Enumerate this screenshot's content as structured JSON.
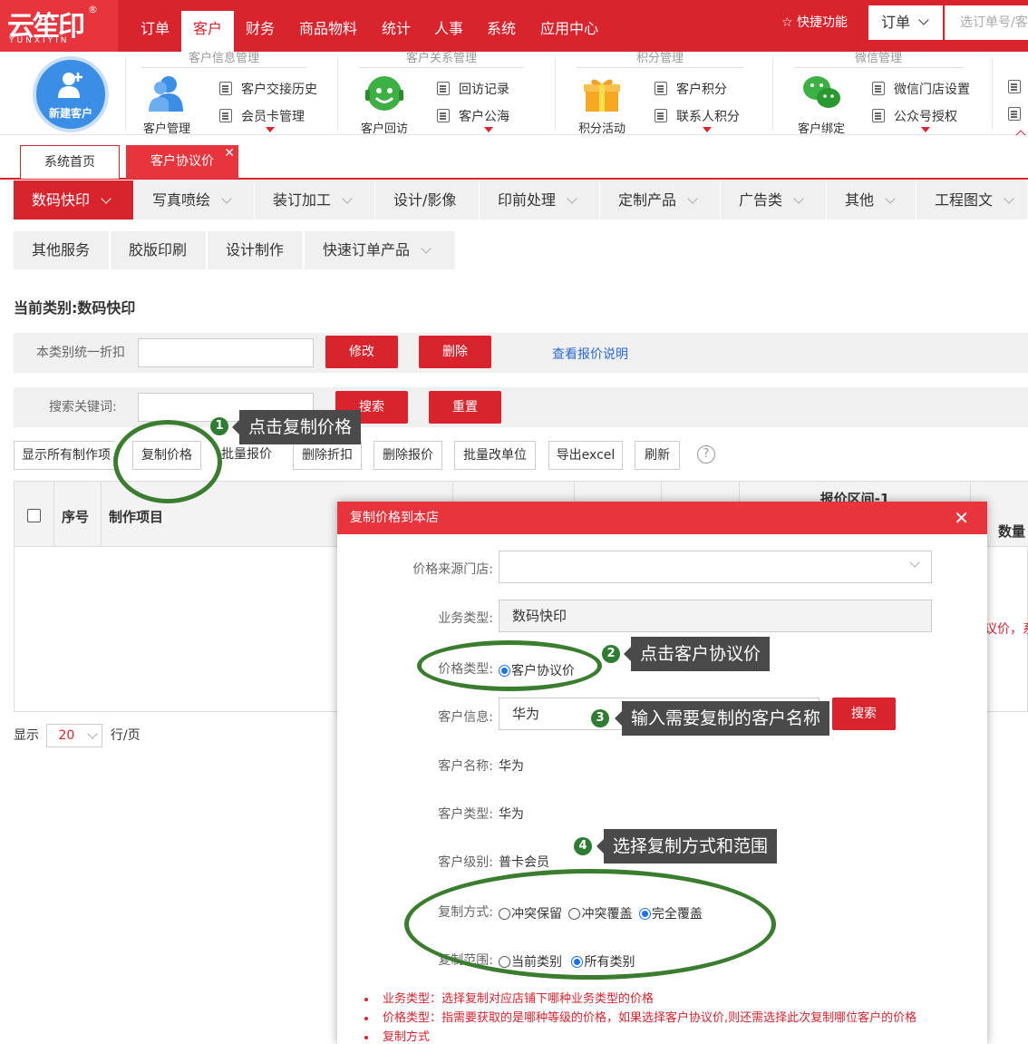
{
  "app": {
    "logo_text": "云笙印",
    "logo_sub": "YUNXIYIN",
    "nav": [
      "订单",
      "客户",
      "财务",
      "商品物料",
      "统计",
      "人事",
      "系统",
      "应用中心"
    ],
    "active_nav": "客户",
    "quick_func": "☆ 快捷功能",
    "order_select": "订单",
    "order_search_placeholder": "选订单号/客"
  },
  "ribbon": {
    "new_customer": "新建客户",
    "groups": [
      {
        "title": "客户信息管理",
        "big": "客户管理",
        "links": [
          "客户交接历史",
          "会员卡管理"
        ]
      },
      {
        "title": "客户关系管理",
        "big": "客户回访",
        "links": [
          "回访记录",
          "客户公海"
        ]
      },
      {
        "title": "积分管理",
        "big": "积分活动",
        "links": [
          "客户积分",
          "联系人积分"
        ]
      },
      {
        "title": "微信管理",
        "big": "客户绑定",
        "links": [
          "微信门店设置",
          "公众号授权"
        ]
      }
    ]
  },
  "tabs": {
    "home": "系统首页",
    "current": "客户协议价"
  },
  "categories": [
    "数码快印",
    "写真喷绘",
    "装订加工",
    "设计/影像",
    "印前处理",
    "定制产品",
    "广告类",
    "其他",
    "工程图文"
  ],
  "subcategories": [
    "其他服务",
    "胶版印刷",
    "设计制作",
    "快速订单产品"
  ],
  "current_category": "当前类别:数码快印",
  "discount_row": {
    "label": "本类别统一折扣",
    "modify": "修改",
    "delete": "删除",
    "link": "查看报价说明"
  },
  "search_row": {
    "label": "搜索关键词:",
    "search": "搜索",
    "reset": "重置"
  },
  "toolbar": [
    "显示所有制作项",
    "复制价格",
    "批量报价",
    "删除折扣",
    "删除报价",
    "批量改单位",
    "导出excel",
    "刷新"
  ],
  "table": {
    "seq": "序号",
    "item": "制作项目",
    "range": "报价区间-1",
    "qty": "数量",
    "overflow_text": "议价，系"
  },
  "pager": {
    "show": "显示",
    "size": "20",
    "unit": "行/页"
  },
  "modal": {
    "title": "复制价格到本店",
    "source_store_label": "价格来源门店:",
    "source_store_value": "",
    "biz_type_label": "业务类型:",
    "biz_type_value": "数码快印",
    "price_type_label": "价格类型:",
    "price_type_option": "客户协议价",
    "cust_info_label": "客户信息:",
    "cust_info_value": "华为",
    "search_btn": "搜索",
    "cust_name_label": "客户名称:",
    "cust_name_value": "华为",
    "cust_type_label": "客户类型:",
    "cust_type_value": "华为",
    "cust_level_label": "客户级别:",
    "cust_level_value": "普卡会员",
    "copy_mode_label": "复制方式:",
    "copy_mode_options": [
      "冲突保留",
      "冲突覆盖",
      "完全覆盖"
    ],
    "copy_mode_selected": "完全覆盖",
    "copy_scope_label": "复制范围:",
    "copy_scope_options": [
      "当前类别",
      "所有类别"
    ],
    "copy_scope_selected": "所有类别",
    "notes": [
      "业务类型：选择复制对应店铺下哪种业务类型的价格",
      "价格类型：指需要获取的是哪种等级的价格，如果选择客户协议价,则还需选择此次复制哪位客户的价格",
      "复制方式"
    ]
  },
  "annotations": [
    {
      "num": "1",
      "text": "点击复制价格"
    },
    {
      "num": "2",
      "text": "点击客户协议价"
    },
    {
      "num": "3",
      "text": "输入需要复制的客户名称"
    },
    {
      "num": "4",
      "text": "选择复制方式和范围"
    }
  ],
  "colors": {
    "brand_red": "#d9232d",
    "annotation_green": "#3b7d2f",
    "callout_bg": "#4a4a4a",
    "link_blue": "#2a6ad8"
  }
}
